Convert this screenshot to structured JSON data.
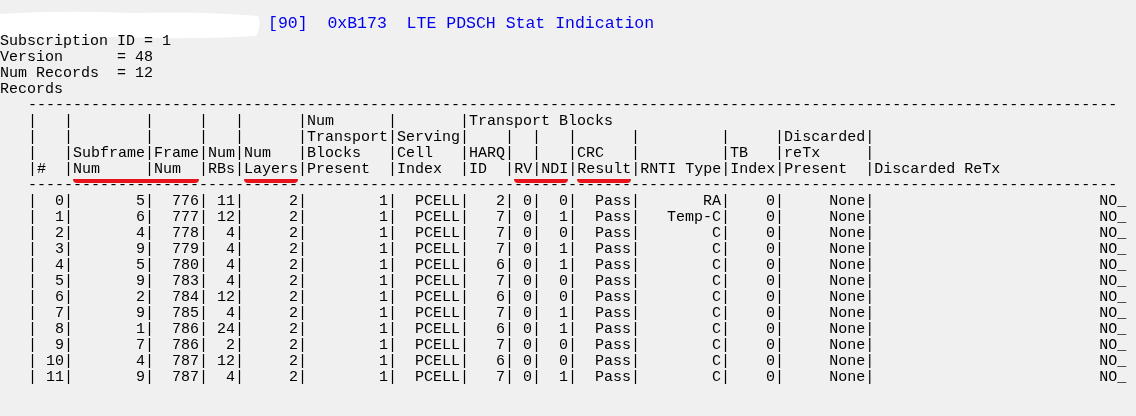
{
  "title": "[90]  0xB173  LTE PDSCH Stat Indication",
  "fields": [
    "Subscription ID = 1",
    "Version      = 48",
    "Num Records  = 12",
    "Records"
  ],
  "table": {
    "rule_top": "-------------------------------------------------------------------------------------------------------------------------",
    "header_lines": [
      "|   |        |     |   |      |Num      |       |Transport Blocks",
      "|   |        |     |   |      |Transport|Serving|    |  |   |      |         |     |Discarded|",
      "|   |Subframe|Frame|Num|Num   |Blocks   |Cell   |HARQ|  |   |CRC   |         |TB   |reTx     |"
    ],
    "label_line": [
      {
        "text": "|#  |",
        "underlined": false
      },
      {
        "text": "Num     |Num  ",
        "underlined": true
      },
      {
        "text": "|RBs|",
        "underlined": false
      },
      {
        "text": "Layers",
        "underlined": true
      },
      {
        "text": "|Present  |Index  |ID  |",
        "underlined": false
      },
      {
        "text": "RV|NDI",
        "underlined": true
      },
      {
        "text": "|",
        "underlined": false
      },
      {
        "text": "Result",
        "underlined": true
      },
      {
        "text": "|RNTI Type|Index|Present  |Discarded ReTx",
        "underlined": false
      }
    ],
    "rule_bottom": "-------------------------------------------------------------------------------------------------------------------------",
    "rows": [
      "|  0|       5|  776| 11|     2|        1|  PCELL|   2| 0|  0|  Pass|       RA|    0|     None|                         NO_",
      "|  1|       6|  777| 12|     2|        1|  PCELL|   7| 0|  1|  Pass|   Temp-C|    0|     None|                         NO_",
      "|  2|       4|  778|  4|     2|        1|  PCELL|   7| 0|  0|  Pass|        C|    0|     None|                         NO_",
      "|  3|       9|  779|  4|     2|        1|  PCELL|   7| 0|  1|  Pass|        C|    0|     None|                         NO_",
      "|  4|       5|  780|  4|     2|        1|  PCELL|   6| 0|  1|  Pass|        C|    0|     None|                         NO_",
      "|  5|       9|  783|  4|     2|        1|  PCELL|   7| 0|  0|  Pass|        C|    0|     None|                         NO_",
      "|  6|       2|  784| 12|     2|        1|  PCELL|   6| 0|  0|  Pass|        C|    0|     None|                         NO_",
      "|  7|       9|  785|  4|     2|        1|  PCELL|   7| 0|  1|  Pass|        C|    0|     None|                         NO_",
      "|  8|       1|  786| 24|     2|        1|  PCELL|   6| 0|  1|  Pass|        C|    0|     None|                         NO_",
      "|  9|       7|  786|  2|     2|        1|  PCELL|   7| 0|  0|  Pass|        C|    0|     None|                         NO_",
      "| 10|       4|  787| 12|     2|        1|  PCELL|   6| 0|  0|  Pass|        C|    0|     None|                         NO_",
      "| 11|       9|  787|  4|     2|        1|  PCELL|   7| 0|  1|  Pass|        C|    0|     None|                         NO_"
    ]
  }
}
